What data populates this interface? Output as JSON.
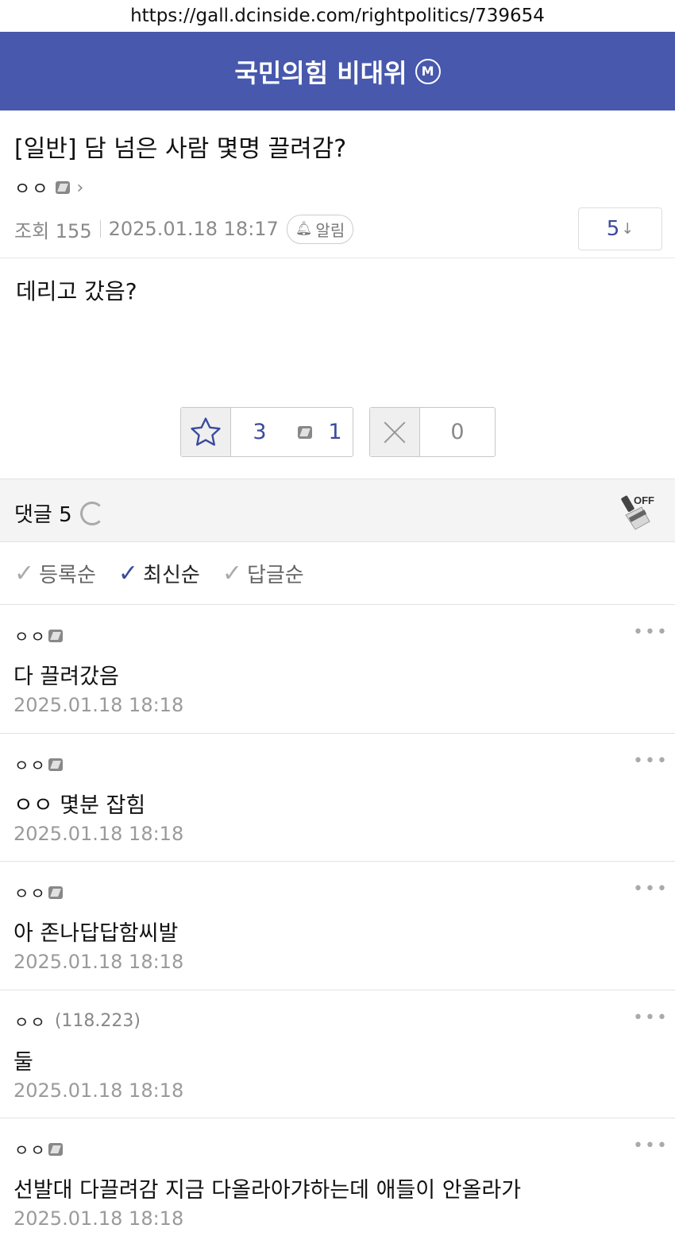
{
  "url": "https://gall.dcinside.com/rightpolitics/739654",
  "gallery": {
    "title": "국민의힘 비대위",
    "minor_badge": "M"
  },
  "post": {
    "title": "[일반] 담 넘은 사람 몇명 끌려감?",
    "author": "ㅇㅇ",
    "views": "조회 155",
    "datetime": "2025.01.18 18:17",
    "alarm_label": "알림",
    "comment_jump": "5",
    "comment_jump_arrow": "↓",
    "body": "데리고 갔음?"
  },
  "votes": {
    "up": "3",
    "fixed_up": "1",
    "down": "0"
  },
  "comments_header": {
    "label": "댓글 5"
  },
  "sort_options": [
    {
      "label": "등록순",
      "active": false
    },
    {
      "label": "최신순",
      "active": true
    },
    {
      "label": "답글순",
      "active": false
    }
  ],
  "comments": [
    {
      "author": "ㅇㅇ",
      "ip": "",
      "text": "다 끌려갔음",
      "date": "2025.01.18 18:18"
    },
    {
      "author": "ㅇㅇ",
      "ip": "",
      "text": "ㅇㅇ 몇분 잡힘",
      "date": "2025.01.18 18:18"
    },
    {
      "author": "ㅇㅇ",
      "ip": "",
      "text": "아 존나답답함씨발",
      "date": "2025.01.18 18:18"
    },
    {
      "author": "ㅇㅇ",
      "ip": "(118.223)",
      "text": "둘",
      "date": "2025.01.18 18:18"
    },
    {
      "author": "ㅇㅇ",
      "ip": "",
      "text": "선발대 다끌려감 지금 다올라아갸하는데 애들이 안올라가",
      "date": "2025.01.18 18:18"
    }
  ],
  "icons": {
    "star": "star-icon",
    "close": "x-icon",
    "refresh": "refresh-icon",
    "broom": "broom-off-icon",
    "bell": "bell-icon",
    "more": "more-dots-icon"
  },
  "colors": {
    "header_bg": "#4758ad",
    "accent": "#3b4a9c"
  }
}
